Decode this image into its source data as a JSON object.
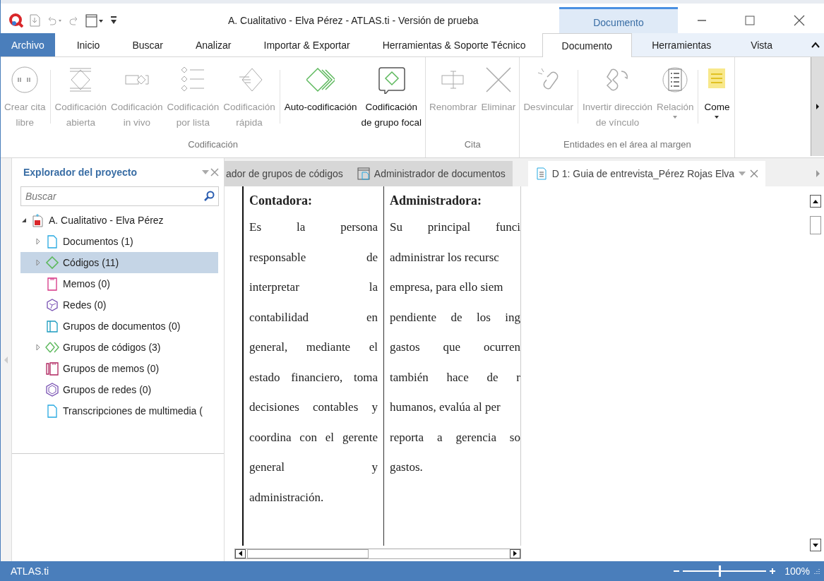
{
  "window": {
    "title": "A. Cualitativo - Elva Pérez - ATLAS.ti - Versión de prueba",
    "context_header": "Documento"
  },
  "menu_tabs": [
    {
      "label": "Archivo",
      "kind": "file",
      "selected": false
    },
    {
      "label": "Inicio",
      "kind": "normal",
      "selected": false
    },
    {
      "label": "Buscar",
      "kind": "normal",
      "selected": false
    },
    {
      "label": "Analizar",
      "kind": "normal",
      "selected": false
    },
    {
      "label": "Importar & Exportar",
      "kind": "normal",
      "selected": false
    },
    {
      "label": "Herramientas & Soporte Técnico",
      "kind": "normal",
      "selected": false
    },
    {
      "label": "Documento",
      "kind": "context",
      "selected": true
    },
    {
      "label": "Herramientas",
      "kind": "context",
      "selected": false
    },
    {
      "label": "Vista",
      "kind": "context",
      "selected": false
    }
  ],
  "ribbon": {
    "groups": [
      {
        "label": "Codificación",
        "sections": [
          [
            {
              "label": "Crear cita\nlibre",
              "disabled": true
            }
          ],
          [
            {
              "label": "Codificación\nabierta",
              "disabled": true
            },
            {
              "label": "Codificación\nin vivo",
              "disabled": true
            },
            {
              "label": "Codificación\npor lista",
              "disabled": true
            },
            {
              "label": "Codificación\nrápida",
              "disabled": true
            }
          ],
          [
            {
              "label": "Auto-codificación",
              "disabled": false
            },
            {
              "label": "Codificación\nde grupo focal",
              "disabled": false
            }
          ]
        ]
      },
      {
        "label": "Cita",
        "sections": [
          [
            {
              "label": "Renombrar",
              "disabled": true
            },
            {
              "label": "Eliminar",
              "disabled": true
            }
          ]
        ]
      },
      {
        "label": "Entidades en el área al margen",
        "sections": [
          [
            {
              "label": "Desvincular",
              "disabled": true
            }
          ],
          [
            {
              "label": "Invertir dirección\nde vínculo",
              "disabled": true
            },
            {
              "label": "Relación",
              "disabled": true,
              "dropdown": true
            }
          ],
          [
            {
              "label": "Come",
              "disabled": false,
              "dropdown": true
            }
          ]
        ]
      }
    ]
  },
  "explorer": {
    "title": "Explorador del proyecto",
    "search": {
      "placeholder": "Buscar"
    },
    "tree": [
      {
        "label": "A. Cualitativo - Elva Pérez",
        "expandable": true,
        "expanded": true,
        "selected": false,
        "children": [
          {
            "label": "Documentos (1)",
            "expandable": true,
            "expanded": false,
            "selected": false
          },
          {
            "label": "Códigos (11)",
            "expandable": true,
            "expanded": false,
            "selected": true
          },
          {
            "label": "Memos (0)",
            "expandable": false,
            "selected": false
          },
          {
            "label": "Redes (0)",
            "expandable": false,
            "selected": false
          },
          {
            "label": "Grupos de documentos (0)",
            "expandable": false,
            "selected": false
          },
          {
            "label": "Grupos de códigos (3)",
            "expandable": true,
            "expanded": false,
            "selected": false
          },
          {
            "label": "Grupos de memos (0)",
            "expandable": false,
            "selected": false
          },
          {
            "label": "Grupos de redes (0)",
            "expandable": false,
            "selected": false
          },
          {
            "label": "Transcripciones de multimedia (",
            "expandable": false,
            "selected": false
          }
        ]
      }
    ]
  },
  "doc_tabs": [
    {
      "label": "ador de grupos de códigos",
      "selected": false
    },
    {
      "label": "Administrador de documentos",
      "selected": false
    },
    {
      "label": "D 1: Guia de entrevista_Pérez Rojas Elva",
      "selected": true
    }
  ],
  "document": {
    "columns": [
      {
        "heading": "Contadora:",
        "lines": [
          {
            "text": "Es la persona",
            "justify": true
          },
          {
            "text": "responsable de",
            "justify": true
          },
          {
            "text": "interpretar la",
            "justify": true
          },
          {
            "text": "contabilidad en",
            "justify": true
          },
          {
            "text": "general, mediante el",
            "justify": true
          },
          {
            "text": "estado financiero, toma",
            "justify": true
          },
          {
            "text": "decisiones contables y",
            "justify": true
          },
          {
            "text": "coordina con el gerente",
            "justify": true
          },
          {
            "text": "general y",
            "justify": true
          },
          {
            "text": "administración."
          }
        ]
      },
      {
        "heading": "Administradora:",
        "lines": [
          {
            "text": "Su principal funci",
            "justify": true
          },
          {
            "text": "administrar los recursc",
            "justify": false
          },
          {
            "text": "empresa, para ello siem",
            "justify": false
          },
          {
            "text": "pendiente de los ing",
            "justify": true
          },
          {
            "text": "gastos que ocurren",
            "justify": true
          },
          {
            "text": "también hace de r",
            "justify": true
          },
          {
            "text": "humanos, evalúa al per",
            "justify": false
          },
          {
            "text": "reporta a gerencia so",
            "justify": true
          },
          {
            "text": "gastos."
          }
        ]
      }
    ]
  },
  "status_bar": {
    "app": "ATLAS.ti",
    "zoom": {
      "level": 0.44,
      "reading": "100%"
    }
  }
}
